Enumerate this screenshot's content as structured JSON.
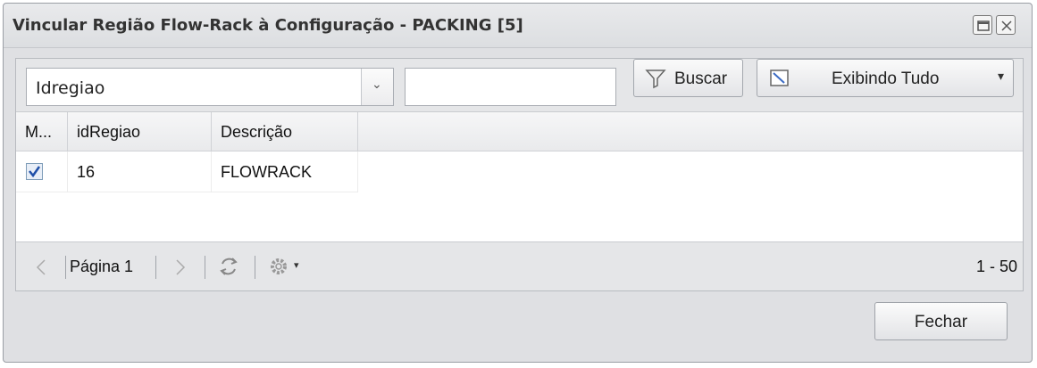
{
  "window": {
    "title": "Vincular Região Flow-Rack à Configuração - PACKING [5]"
  },
  "toolbar": {
    "field_selector_value": "Idregiao",
    "search_value": "",
    "search_button_label": "Buscar",
    "filter_button_label": "Exibindo Tudo"
  },
  "grid": {
    "columns": [
      "M...",
      "idRegiao",
      "Descrição"
    ],
    "rows": [
      {
        "checked": true,
        "idRegiao": "16",
        "descricao": "FLOWRACK"
      }
    ]
  },
  "pager": {
    "page_label": "Página 1",
    "range_label": "1 - 50"
  },
  "footer": {
    "close_button_label": "Fechar"
  },
  "colors": {
    "window_bg": "#dfe0e3",
    "toolbar_bg": "#e5e6e8",
    "checkbox_check": "#1f4fa8"
  }
}
